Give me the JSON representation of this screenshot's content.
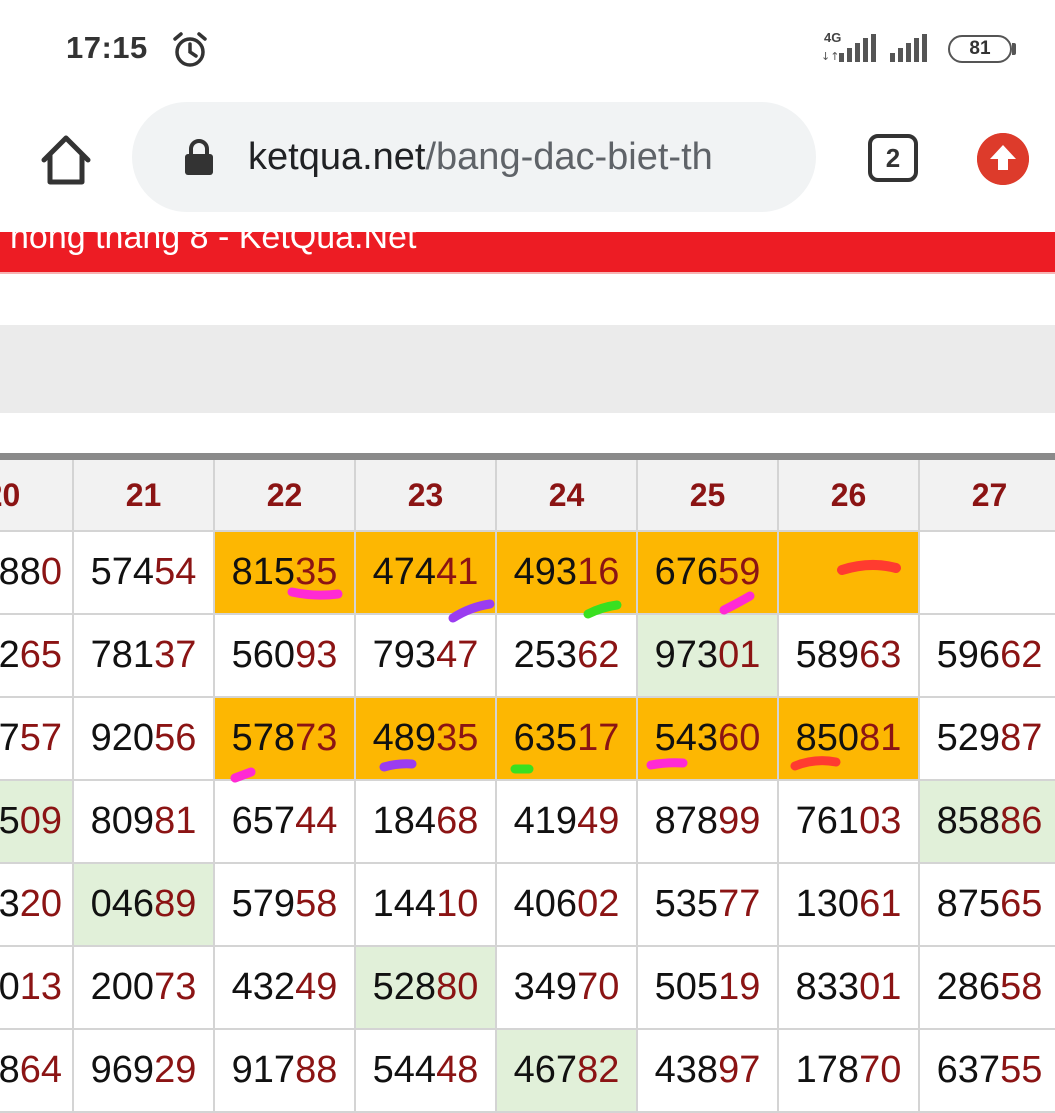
{
  "status_bar": {
    "time": "17:15",
    "network": "4G",
    "battery": "81",
    "icons": [
      "alarm-icon",
      "signal-icon",
      "signal-icon",
      "battery-icon"
    ]
  },
  "browser": {
    "url_domain": "ketqua.net",
    "url_path": "/bang-dac-biet-th",
    "tab_count": "2",
    "icons": [
      "home-icon",
      "lock-icon",
      "tabs-icon",
      "update-icon"
    ]
  },
  "page": {
    "banner_title": "hong thang 8 - KetQua.Net",
    "colors": {
      "banner": "#ed1c24",
      "highlight": "#fdb702",
      "special": "#e1f0d9",
      "tail_digits": "#8b1414"
    }
  },
  "table": {
    "headers": [
      "20",
      "21",
      "22",
      "23",
      "24",
      "25",
      "26",
      "27"
    ],
    "rows": [
      [
        {
          "head": "88",
          "tail": "0",
          "bg": "white"
        },
        {
          "head": "574",
          "tail": "54",
          "bg": "white"
        },
        {
          "head": "815",
          "tail": "35",
          "bg": "orange"
        },
        {
          "head": "474",
          "tail": "41",
          "bg": "orange"
        },
        {
          "head": "493",
          "tail": "16",
          "bg": "orange"
        },
        {
          "head": "676",
          "tail": "59",
          "bg": "orange"
        },
        {
          "head": "",
          "tail": "",
          "bg": "orange"
        },
        {
          "head": "",
          "tail": "",
          "bg": "white"
        }
      ],
      [
        {
          "head": "2",
          "tail": "65",
          "bg": "white"
        },
        {
          "head": "781",
          "tail": "37",
          "bg": "white"
        },
        {
          "head": "560",
          "tail": "93",
          "bg": "white"
        },
        {
          "head": "793",
          "tail": "47",
          "bg": "white"
        },
        {
          "head": "253",
          "tail": "62",
          "bg": "white"
        },
        {
          "head": "973",
          "tail": "01",
          "bg": "green"
        },
        {
          "head": "589",
          "tail": "63",
          "bg": "white"
        },
        {
          "head": "596",
          "tail": "62",
          "bg": "white"
        }
      ],
      [
        {
          "head": "7",
          "tail": "57",
          "bg": "white"
        },
        {
          "head": "920",
          "tail": "56",
          "bg": "white"
        },
        {
          "head": "578",
          "tail": "73",
          "bg": "orange"
        },
        {
          "head": "489",
          "tail": "35",
          "bg": "orange"
        },
        {
          "head": "635",
          "tail": "17",
          "bg": "orange"
        },
        {
          "head": "543",
          "tail": "60",
          "bg": "orange"
        },
        {
          "head": "850",
          "tail": "81",
          "bg": "orange"
        },
        {
          "head": "529",
          "tail": "87",
          "bg": "white"
        }
      ],
      [
        {
          "head": "5",
          "tail": "09",
          "bg": "green"
        },
        {
          "head": "809",
          "tail": "81",
          "bg": "white"
        },
        {
          "head": "657",
          "tail": "44",
          "bg": "white"
        },
        {
          "head": "184",
          "tail": "68",
          "bg": "white"
        },
        {
          "head": "419",
          "tail": "49",
          "bg": "white"
        },
        {
          "head": "878",
          "tail": "99",
          "bg": "white"
        },
        {
          "head": "761",
          "tail": "03",
          "bg": "white"
        },
        {
          "head": "858",
          "tail": "86",
          "bg": "green"
        }
      ],
      [
        {
          "head": "3",
          "tail": "20",
          "bg": "white"
        },
        {
          "head": "046",
          "tail": "89",
          "bg": "green"
        },
        {
          "head": "579",
          "tail": "58",
          "bg": "white"
        },
        {
          "head": "144",
          "tail": "10",
          "bg": "white"
        },
        {
          "head": "406",
          "tail": "02",
          "bg": "white"
        },
        {
          "head": "535",
          "tail": "77",
          "bg": "white"
        },
        {
          "head": "130",
          "tail": "61",
          "bg": "white"
        },
        {
          "head": "875",
          "tail": "65",
          "bg": "white"
        }
      ],
      [
        {
          "head": "0",
          "tail": "13",
          "bg": "white"
        },
        {
          "head": "200",
          "tail": "73",
          "bg": "white"
        },
        {
          "head": "432",
          "tail": "49",
          "bg": "white"
        },
        {
          "head": "528",
          "tail": "80",
          "bg": "green"
        },
        {
          "head": "349",
          "tail": "70",
          "bg": "white"
        },
        {
          "head": "505",
          "tail": "19",
          "bg": "white"
        },
        {
          "head": "833",
          "tail": "01",
          "bg": "white"
        },
        {
          "head": "286",
          "tail": "58",
          "bg": "white"
        }
      ],
      [
        {
          "head": "8",
          "tail": "64",
          "bg": "white"
        },
        {
          "head": "969",
          "tail": "29",
          "bg": "white"
        },
        {
          "head": "917",
          "tail": "88",
          "bg": "white"
        },
        {
          "head": "544",
          "tail": "48",
          "bg": "white"
        },
        {
          "head": "467",
          "tail": "82",
          "bg": "green"
        },
        {
          "head": "438",
          "tail": "97",
          "bg": "white"
        },
        {
          "head": "178",
          "tail": "70",
          "bg": "white"
        },
        {
          "head": "637",
          "tail": "55",
          "bg": "white"
        }
      ]
    ]
  }
}
